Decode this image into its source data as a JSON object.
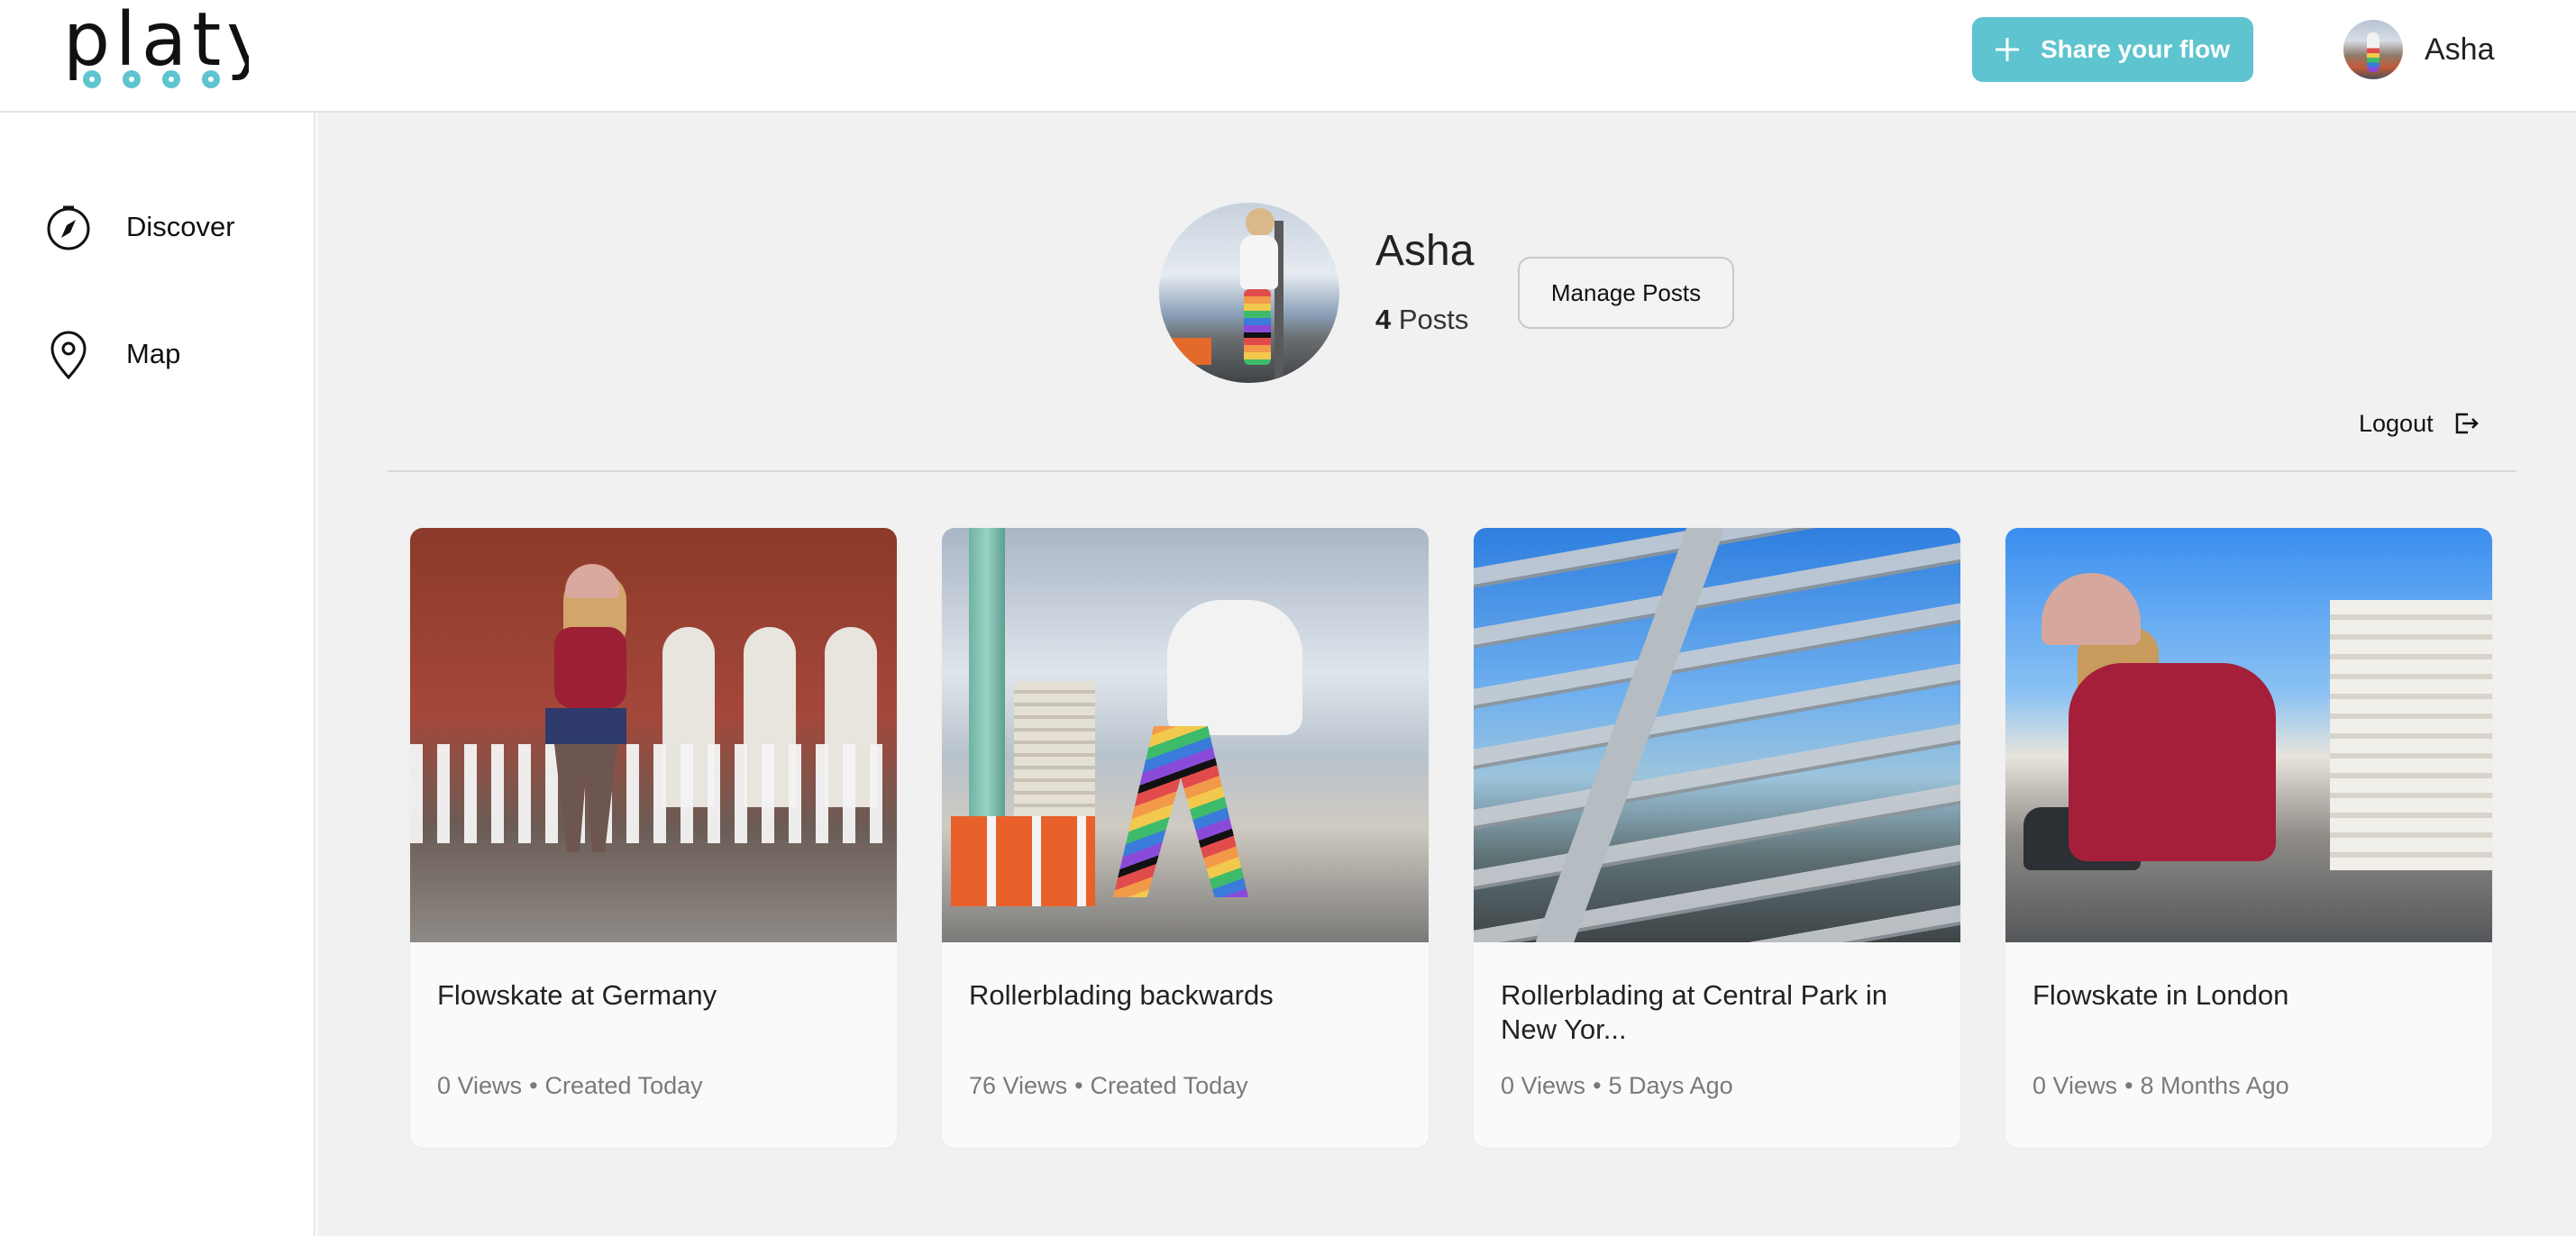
{
  "header": {
    "logo_text": "platy",
    "share_button_label": "Share your flow",
    "user_name": "Asha"
  },
  "sidebar": {
    "items": [
      {
        "label": "Discover",
        "icon": "compass-icon"
      },
      {
        "label": "Map",
        "icon": "map-pin-icon"
      }
    ]
  },
  "profile": {
    "name": "Asha",
    "post_count": "4",
    "post_count_label": "Posts",
    "manage_button_label": "Manage Posts",
    "logout_label": "Logout"
  },
  "posts": [
    {
      "title": "Flowskate at Germany",
      "views": "0 Views",
      "created": "Created Today"
    },
    {
      "title": "Rollerblading backwards",
      "views": "76 Views",
      "created": "Created Today"
    },
    {
      "title": "Rollerblading at Central Park in New Yor...",
      "views": "0 Views",
      "created": "5 Days Ago"
    },
    {
      "title": "Flowskate in London",
      "views": "0 Views",
      "created": "8 Months Ago"
    }
  ],
  "colors": {
    "accent": "#5ec4cf",
    "main_background": "#f1f1f1",
    "card_background": "#fafafa"
  }
}
